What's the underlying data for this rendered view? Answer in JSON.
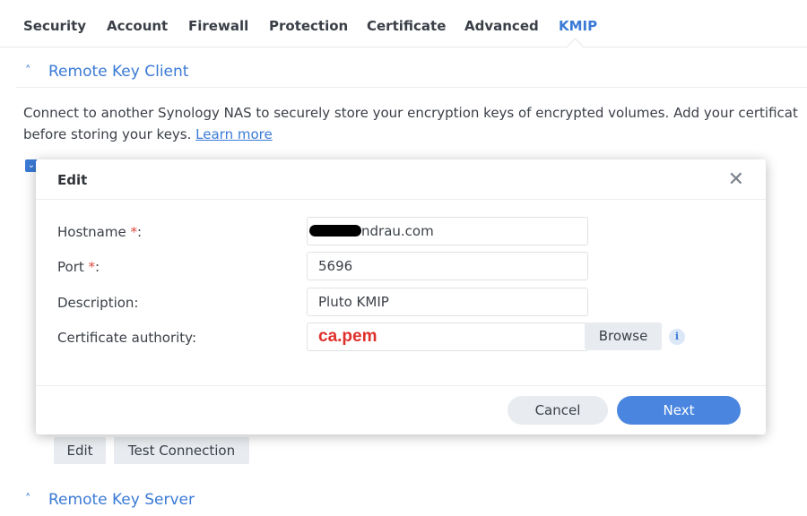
{
  "tabs": [
    {
      "label": "Security"
    },
    {
      "label": "Account"
    },
    {
      "label": "Firewall"
    },
    {
      "label": "Protection"
    },
    {
      "label": "Certificate"
    },
    {
      "label": "Advanced"
    },
    {
      "label": "KMIP",
      "active": true
    }
  ],
  "remote_key_client": {
    "title": "Remote Key Client",
    "description_line1": "Connect to another Synology NAS to securely store your encryption keys of encrypted volumes. Add your certificat",
    "description_line2": "before storing your keys.",
    "learn_more": "Learn more",
    "edit_button": "Edit",
    "test_connection_button": "Test Connection"
  },
  "remote_key_server": {
    "title": "Remote Key Server"
  },
  "dialog": {
    "title": "Edit",
    "fields": {
      "hostname": {
        "label": "Hostname",
        "required_mark": "*",
        "suffix": ":",
        "value": "ndrau.com"
      },
      "port": {
        "label": "Port",
        "required_mark": "*",
        "suffix": ":",
        "value": "5696"
      },
      "description": {
        "label": "Description:",
        "value": "Pluto KMIP"
      },
      "certificate_authority": {
        "label": "Certificate authority:",
        "value": "ca.pem"
      }
    },
    "browse_button": "Browse",
    "cancel_button": "Cancel",
    "next_button": "Next"
  },
  "icons": {
    "close": "close-icon",
    "info": "info-icon",
    "chevron_up": "chevron-up-icon"
  },
  "colors": {
    "accent": "#3a7ad6",
    "primary_button": "#4a86e0",
    "required": "#e0483e",
    "annotation": "#e0302b"
  }
}
